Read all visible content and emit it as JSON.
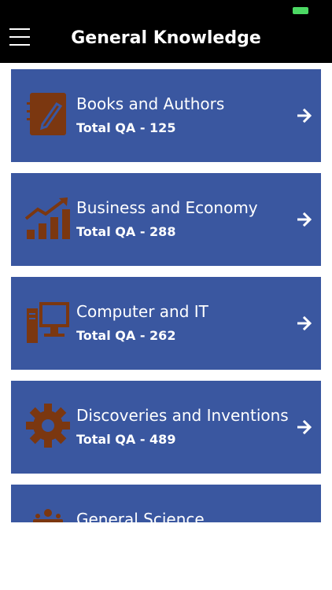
{
  "app_bar": {
    "title": "General Knowledge",
    "menu_icon": "hamburger-menu-icon"
  },
  "colors": {
    "app_bar": "#000000",
    "card_bg": "#3a57a0",
    "icon_color": "#7b3710",
    "text": "#ffffff",
    "battery": "#4cd964"
  },
  "categories": [
    {
      "title": "Books and Authors",
      "subtitle": "Total QA - 125",
      "icon": "notebook-pen-icon"
    },
    {
      "title": "Business and Economy",
      "subtitle": "Total QA - 288",
      "icon": "growth-chart-icon"
    },
    {
      "title": "Computer and IT",
      "subtitle": "Total QA - 262",
      "icon": "desktop-computer-icon"
    },
    {
      "title": "Discoveries and Inventions",
      "subtitle": "Total QA - 489",
      "icon": "gear-icon"
    },
    {
      "title": "General Science",
      "subtitle": "",
      "icon": "science-icon"
    }
  ]
}
